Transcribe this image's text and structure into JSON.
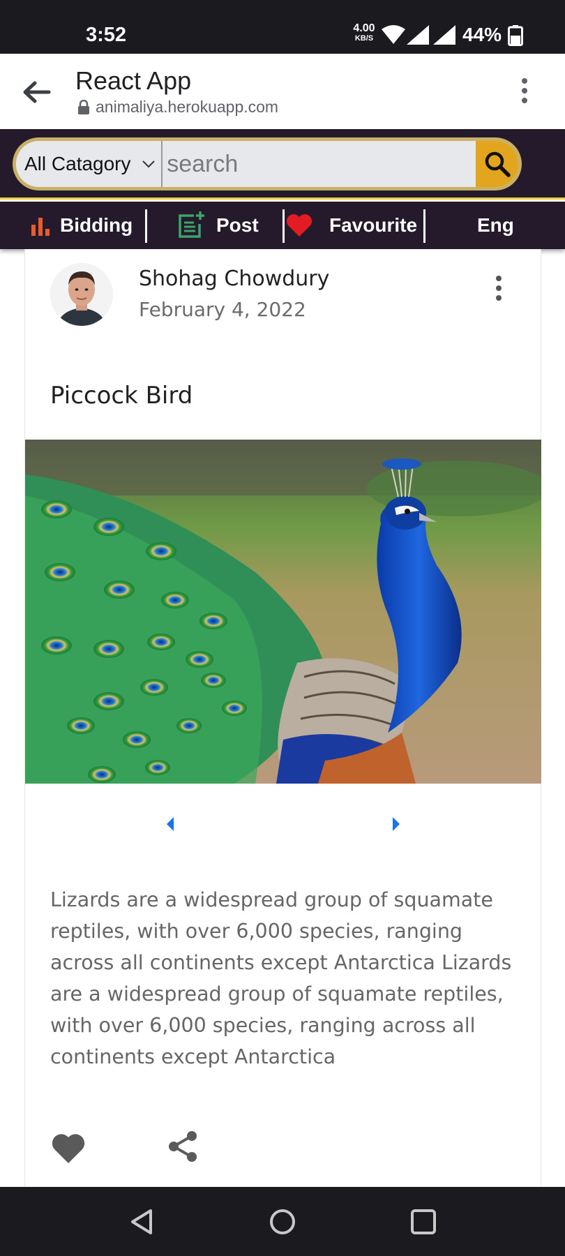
{
  "status_bar": {
    "time": "3:52",
    "net_speed": "4.00",
    "net_unit": "KB/S",
    "battery": "44%"
  },
  "browser": {
    "title": "React App",
    "url": "animaliya.herokuapp.com"
  },
  "search": {
    "category": "All Catagory",
    "placeholder": "search"
  },
  "nav": {
    "bidding": "Bidding",
    "post": "Post",
    "favourite": "Favourite",
    "language": "Eng"
  },
  "post": {
    "author": "Shohag Chowdury",
    "date": "February 4, 2022",
    "title": "Piccock Bird",
    "description": "Lizards are a widespread group of squamate reptiles, with over 6,000 species, ranging across all continents except Antarctica Lizards are a widespread group of squamate reptiles, with over 6,000 species, ranging across all continents except Antarctica"
  },
  "colors": {
    "header_bg": "#241a2c",
    "search_button": "#e2a51d",
    "accent_line": "#e8d43a",
    "carousel_arrow": "#1a73e8",
    "heart_red": "#e31b23"
  },
  "icons": [
    "back-arrow-icon",
    "lock-icon",
    "more-vert-icon",
    "chevron-down-icon",
    "search-icon",
    "bar-chart-icon",
    "post-add-icon",
    "heart-icon",
    "arrow-left-icon",
    "arrow-right-icon",
    "favorite-icon",
    "share-icon"
  ]
}
